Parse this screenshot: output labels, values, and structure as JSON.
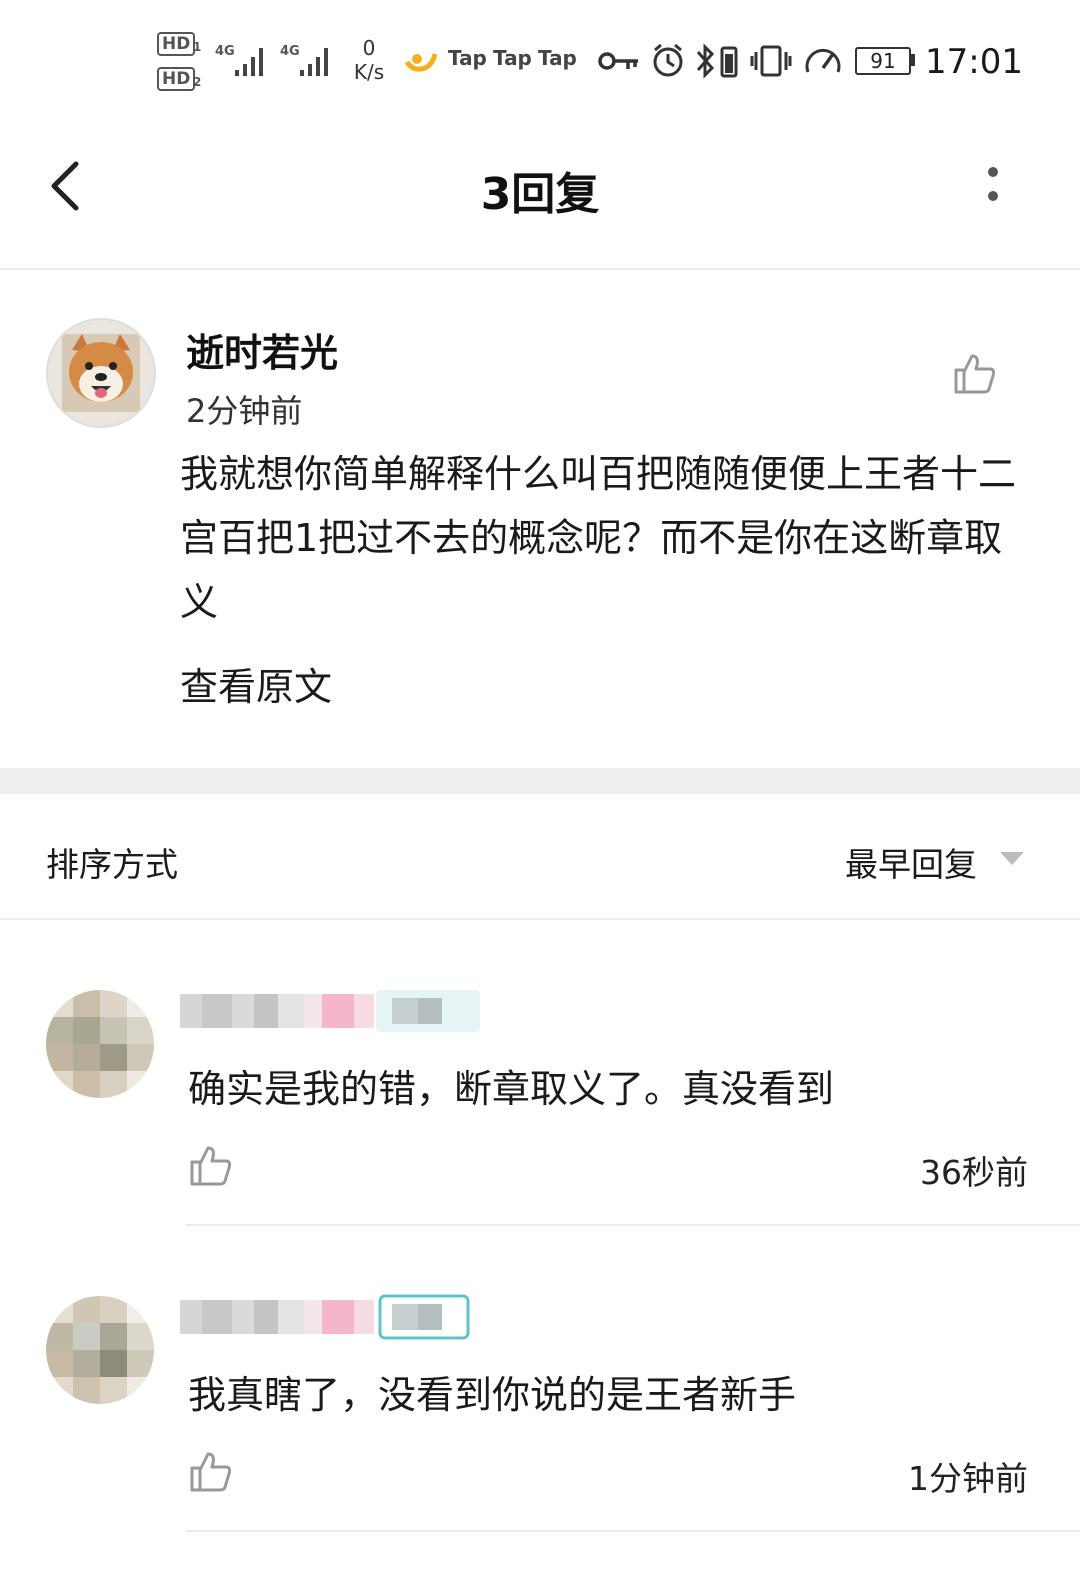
{
  "status_bar": {
    "hd1": "HD",
    "hd1_sub": "1",
    "hd2": "HD",
    "hd2_sub": "2",
    "net1": "4G",
    "net2": "4G",
    "speed_value": "0",
    "speed_unit": "K/s",
    "app_notifications": [
      "Tap",
      "Tap",
      "Tap"
    ],
    "battery": "91",
    "time": "17:01"
  },
  "header": {
    "title": "3回复"
  },
  "main_comment": {
    "username": "逝时若光",
    "time": "2分钟前",
    "text": "我就想你简单解释什么叫百把随随便便上王者十二宫百把1把过不去的概念呢？而不是你在这断章取义",
    "view_original": "查看原文"
  },
  "sort": {
    "label": "排序方式",
    "value": "最早回复"
  },
  "replies": [
    {
      "text": "确实是我的错，断章取义了。真没看到",
      "time": "36秒前"
    },
    {
      "text": "我真瞎了，没看到你说的是王者新手",
      "time": "1分钟前"
    }
  ],
  "colors": {
    "accent_teal": "#5fc3c9",
    "accent_pink": "#f4b6c8",
    "divider": "#ececec",
    "band": "#efefef"
  }
}
